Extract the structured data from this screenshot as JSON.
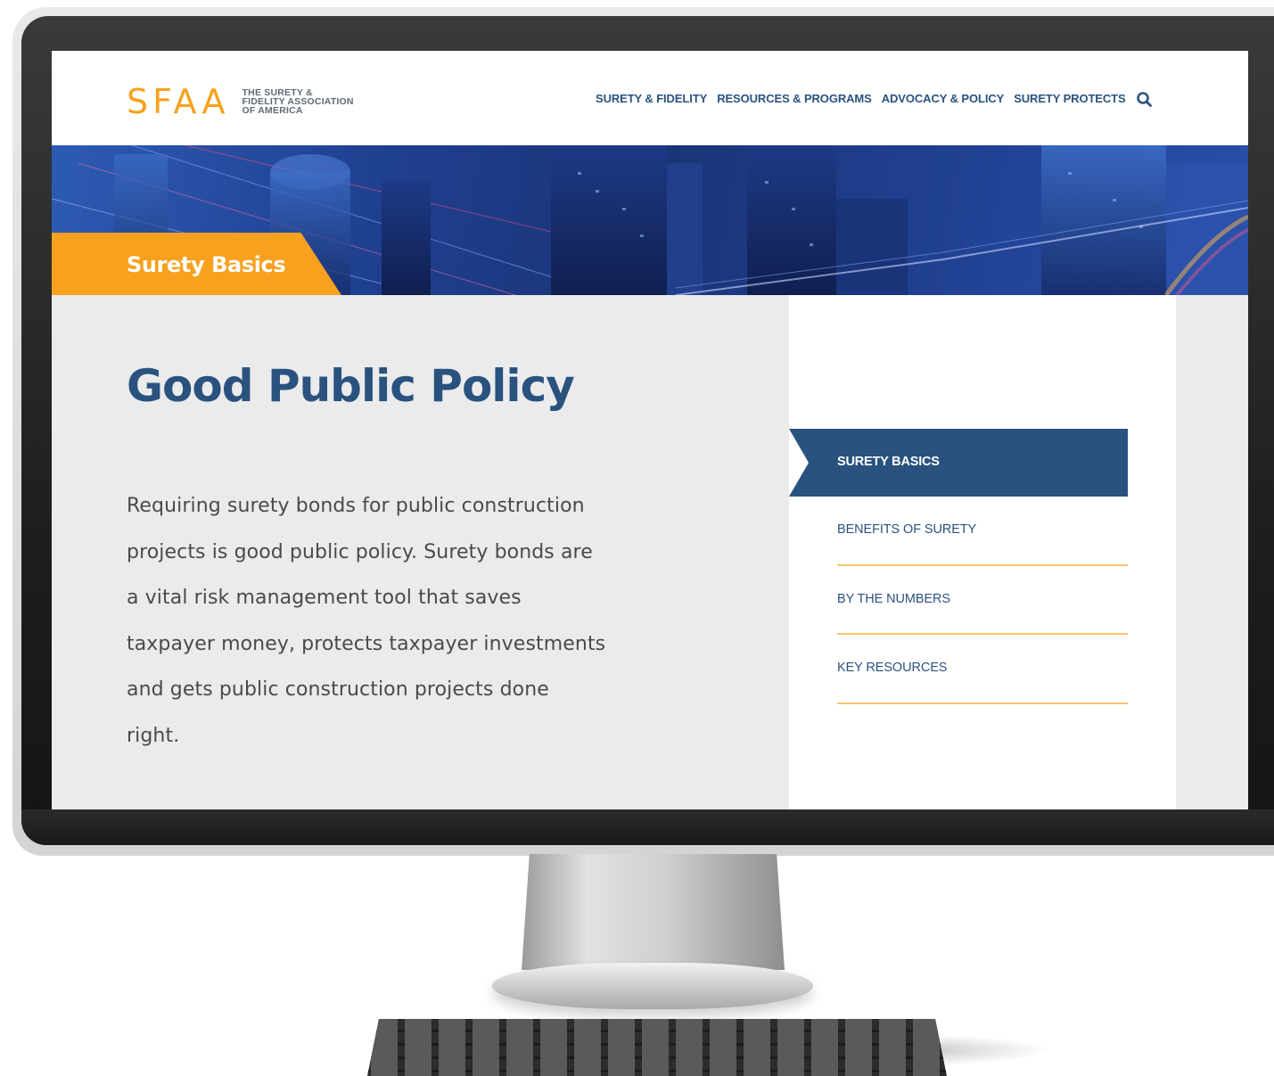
{
  "logo": {
    "mark": "SFAA",
    "text_lines": [
      "THE SURETY &",
      "FIDELITY ASSOCIATION",
      "OF AMERICA"
    ]
  },
  "nav": {
    "items": [
      {
        "label": "SURETY & FIDELITY"
      },
      {
        "label": "RESOURCES & PROGRAMS"
      },
      {
        "label": "ADVOCACY & POLICY"
      },
      {
        "label": "SURETY PROTECTS"
      }
    ],
    "search_icon": "search-icon"
  },
  "hero": {
    "section_label": "Surety Basics"
  },
  "main": {
    "title": "Good Public Policy",
    "body_lines": [
      "Requiring surety bonds for public construction",
      "projects is good public policy. Surety bonds are",
      "a vital risk management tool that saves",
      "taxpayer money, protects taxpayer investments",
      "and gets public construction projects done",
      "right."
    ]
  },
  "sidebar": {
    "active": {
      "label": "SURETY BASICS"
    },
    "items": [
      {
        "label": "BENEFITS OF SURETY"
      },
      {
        "label": "BY THE NUMBERS"
      },
      {
        "label": "KEY RESOURCES"
      }
    ]
  },
  "colors": {
    "brand_orange": "#f7a11e",
    "brand_navy": "#29527f",
    "divider": "#f7c370"
  }
}
